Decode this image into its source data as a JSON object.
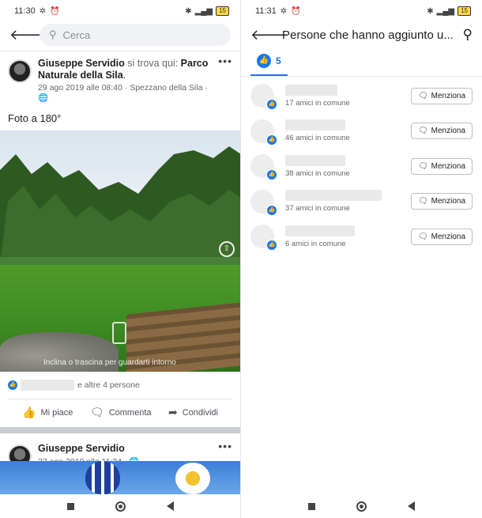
{
  "left": {
    "status": {
      "time": "11:30",
      "battery": "15"
    },
    "search": {
      "placeholder": "Cerca"
    },
    "post1": {
      "author": "Giuseppe Servidio",
      "location_prefix": "si trova qui:",
      "location": "Parco Naturale della Sila",
      "date": "29 ago 2019 alle 08:40",
      "place": "Spezzano della Sila",
      "caption": "Foto a 180°",
      "photo_hint": "Inclina o trascina per guardarti intorno",
      "reactions_text": "e altre 4 persone",
      "actions": {
        "like": "Mi piace",
        "comment": "Commenta",
        "share": "Condividi"
      }
    },
    "post2": {
      "author": "Giuseppe Servidio",
      "date": "27 ago 2019 alle 11:24"
    }
  },
  "right": {
    "status": {
      "time": "11:31",
      "battery": "15"
    },
    "title": "Persone che hanno aggiunto u...",
    "tab_count": "5",
    "people": [
      {
        "mutual": "17 amici in comune",
        "mention": "Menziona"
      },
      {
        "mutual": "46 amici in comune",
        "mention": "Menziona"
      },
      {
        "mutual": "38 amici in comune",
        "mention": "Menziona"
      },
      {
        "mutual": "37 amici in comune",
        "mention": "Menziona"
      },
      {
        "mutual": "6 amici in comune",
        "mention": "Menziona"
      }
    ]
  },
  "colors": {
    "accent": "#1877f2",
    "text": "#1c1e21",
    "muted": "#65676b"
  },
  "icons": [
    "back-arrow-icon",
    "search-icon",
    "more-icon",
    "globe-icon",
    "like-icon",
    "comment-icon",
    "share-icon",
    "mention-icon"
  ]
}
